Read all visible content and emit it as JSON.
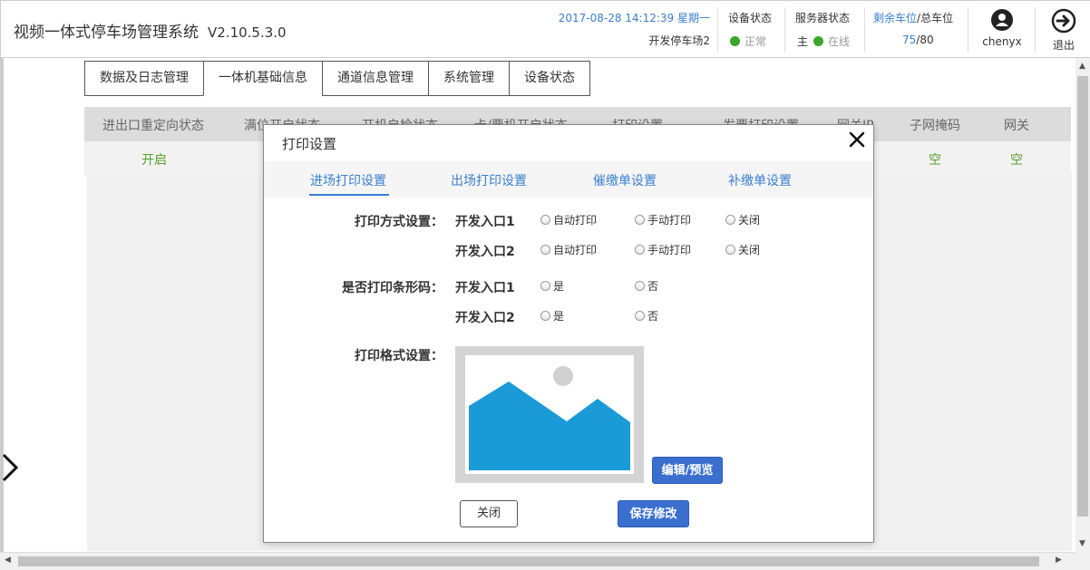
{
  "header": {
    "app_title": "视频一体式停车场管理系统",
    "version": "V2.10.5.3.0",
    "datetime": "2017-08-28 14:12:39 星期一",
    "parking_lot": "开发停车场2",
    "device_status_label": "设备状态",
    "device_status_value": "正常",
    "server_status_label": "服务器状态",
    "server_role": "主",
    "server_status_value": "在线",
    "capacity_label_remaining": "剩余车位",
    "capacity_label_sep": "/",
    "capacity_label_total": "总车位",
    "capacity_remaining": "75",
    "capacity_sep": "/",
    "capacity_total": "80",
    "user_name": "chenyx",
    "logout_label": "退出"
  },
  "main_tabs": [
    {
      "label": "数据及日志管理"
    },
    {
      "label": "一体机基础信息"
    },
    {
      "label": "通道信息管理"
    },
    {
      "label": "系统管理"
    },
    {
      "label": "设备状态"
    }
  ],
  "table": {
    "columns": [
      "进出口重定向状态",
      "满位开启状态",
      "开机自检状态",
      "卡/票机开启状态",
      "打印设置",
      "发票打印设置",
      "网关IP",
      "子网掩码",
      "网关"
    ],
    "row": {
      "redirect": "开启",
      "subnet": "空",
      "gateway": "空"
    }
  },
  "modal": {
    "title": "打印设置",
    "tabs": [
      {
        "label": "进场打印设置"
      },
      {
        "label": "出场打印设置"
      },
      {
        "label": "催缴单设置"
      },
      {
        "label": "补缴单设置"
      }
    ],
    "print_mode_label": "打印方式设置：",
    "barcode_label": "是否打印条形码：",
    "format_label": "打印格式设置：",
    "entrance1": "开发入口1",
    "entrance2": "开发入口2",
    "opt_auto": "自动打印",
    "opt_manual": "手动打印",
    "opt_off": "关闭",
    "opt_yes": "是",
    "opt_no": "否",
    "edit_preview_button": "编辑/预览",
    "close_button": "关闭",
    "save_button": "保存修改"
  },
  "colors": {
    "accent_blue": "#3a7fd0",
    "button_blue": "#3a6fd0",
    "status_green": "#3aa62a",
    "value_green": "#5aa02c",
    "image_blue": "#1a9ad6"
  },
  "icons": [
    "user-icon",
    "logout-icon",
    "close-icon",
    "left-chevron-icon",
    "image-placeholder-icon"
  ]
}
